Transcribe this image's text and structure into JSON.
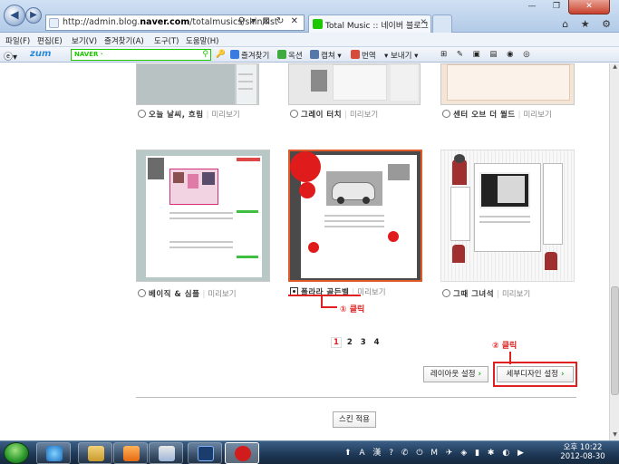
{
  "browser": {
    "address": "http://admin.blog.naver.com/totalmusics/skin/list",
    "address_domain": "naver.com",
    "address_tools": "⚲ ▾ ⊠ ↻ ✕",
    "tab_title": "Total Music :: 네이버 블로그",
    "tab_close": "✕",
    "back": "◀",
    "forward": "▶",
    "minimize": "—",
    "maximize": "❐",
    "close": "✕",
    "right_icons": "⌂ ★ ⚙"
  },
  "menu": [
    "파일(F)",
    "편집(E)",
    "보기(V)",
    "즐겨찾기(A)",
    "도구(T)",
    "도움말(H)"
  ],
  "toolbar": {
    "zum": "zum",
    "naver_label": "NAVER ·",
    "naver_search_icon": "⚲",
    "items": [
      "즐겨찾기",
      "옥션",
      "캡쳐 ▾",
      "번역",
      "▾ 보내기 ▾"
    ],
    "end_icons": "⊞ ✎ ▣ ▤ ◉ ◎"
  },
  "skins_row1": [
    {
      "name": "오늘 날씨, 흐림",
      "preview": "미리보기"
    },
    {
      "name": "그레이 터치",
      "preview": "미리보기"
    },
    {
      "name": "센터 오브 더 월드",
      "preview": "미리보기"
    }
  ],
  "skins_row2": [
    {
      "name": "베이직 & 심플",
      "preview": "미리보기"
    },
    {
      "name": "폴라라 골든벨",
      "preview": "미리보기"
    },
    {
      "name": "그때 그녀석",
      "preview": "미리보기"
    }
  ],
  "annotations": {
    "step1": "① 클릭",
    "step2": "② 클릭"
  },
  "pagination": [
    "1",
    "2",
    "3",
    "4"
  ],
  "buttons": {
    "layout": "레이아웃 설정",
    "detail": "세부디자인 설정",
    "apply": "스킨 적용",
    "arrow": "›"
  },
  "scrollbar": {
    "up": "▲",
    "down": "▼"
  },
  "taskbar": {
    "tray": "⬆ A 漢 ? ✆ ⏻ M ✈ ◈ ▮ ✱ ◐ ▶",
    "time": "오후 10:22",
    "date": "2012-08-30"
  },
  "colors": {
    "annotation": "#e02020",
    "naver_green": "#1ec800",
    "selected_border": "#e05a2a"
  }
}
